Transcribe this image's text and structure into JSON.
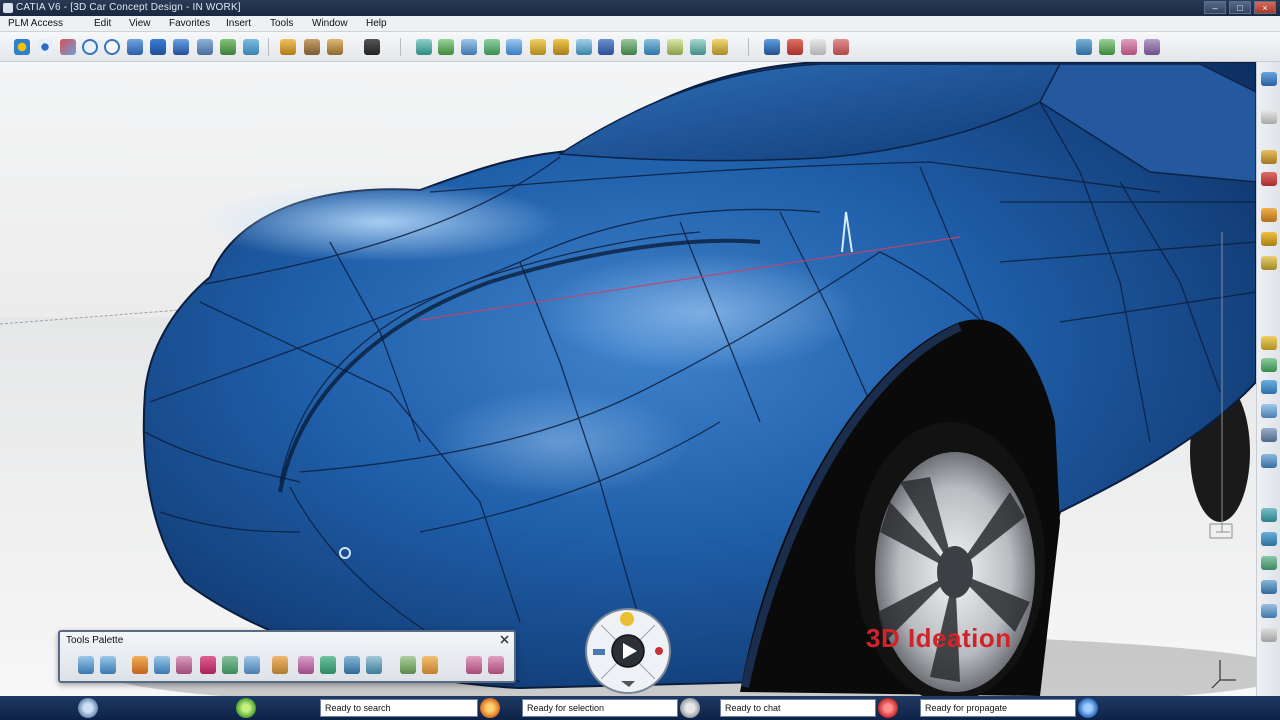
{
  "window": {
    "title": "CATIA V6 - [3D Car Concept Design - IN WORK]"
  },
  "menu": [
    "PLM Access",
    "Edit",
    "View",
    "Favorites",
    "Insert",
    "Tools",
    "Window",
    "Help"
  ],
  "palette": {
    "title": "Tools Palette"
  },
  "watermark": "3D Ideation",
  "status": {
    "search": "Ready to search",
    "selection": "Ready for selection",
    "chat": "Ready to chat",
    "propagate": "Ready for propagate"
  },
  "colors": {
    "car_body": "#1f5ea8",
    "status_bar": "#1a3258",
    "watermark": "#d0242b"
  },
  "icons": {
    "toolbar": [
      "fit-all-icon",
      "pan-icon",
      "rotate-icon",
      "zoom-in-icon",
      "zoom-out-icon",
      "normal-view-icon",
      "view-mode-icon",
      "multi-view-icon",
      "hide-show-icon",
      "swap-visible-icon",
      "capture-icon",
      "sketch-icon",
      "curve-icon",
      "surface-icon",
      "blend-icon",
      "fill-icon",
      "sweep-icon",
      "extrude-icon",
      "offset-icon",
      "split-icon",
      "trim-icon",
      "join-icon",
      "analysis-icon",
      "material-icon",
      "render-icon",
      "compass-icon",
      "undo-icon",
      "redo-icon"
    ]
  }
}
